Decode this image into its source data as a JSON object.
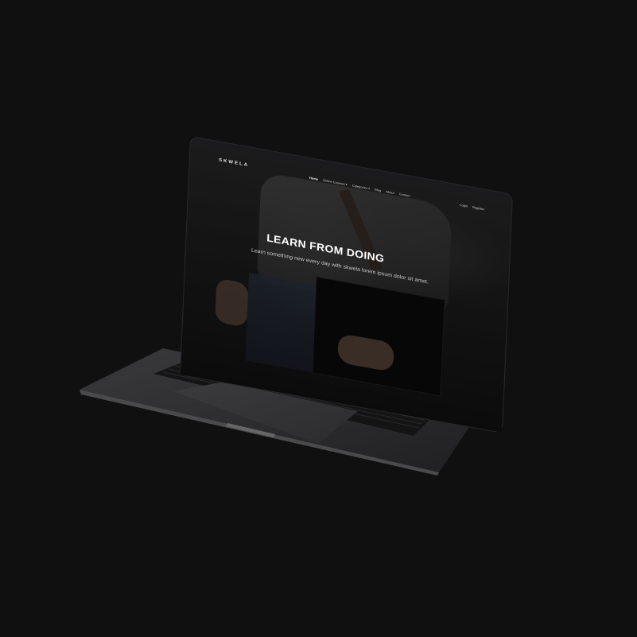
{
  "site": {
    "brand": "SKWELA",
    "nav": [
      {
        "label": "Home",
        "active": true
      },
      {
        "label": "Online Courses ▾",
        "active": false
      },
      {
        "label": "Categories ▾",
        "active": false
      },
      {
        "label": "Blog",
        "active": false
      },
      {
        "label": "About",
        "active": false
      },
      {
        "label": "Contact",
        "active": false
      }
    ],
    "auth": {
      "login": "Login",
      "register": "Register"
    },
    "hero": {
      "title": "LEARN FROM DOING",
      "subtitle": "Learn something new every day with skwela lorem ipsum dolor sit amet."
    }
  },
  "colors": {
    "background": "#101010",
    "laptop_body": "#2b2b2d",
    "hero_text": "#ffffff"
  }
}
